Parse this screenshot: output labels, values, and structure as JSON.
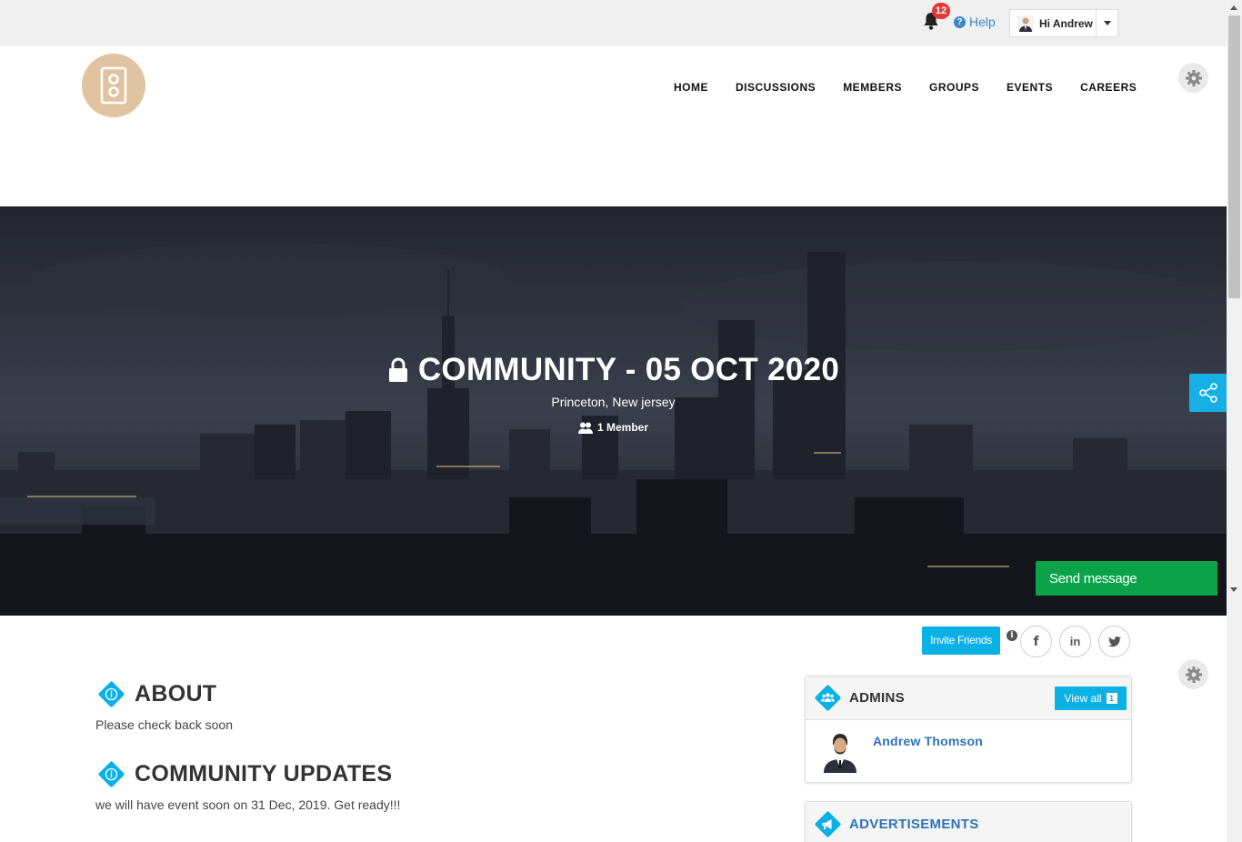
{
  "topbar": {
    "notification_count": "12",
    "help_label": "Help",
    "user_greeting": "Hi Andrew"
  },
  "nav": {
    "items": [
      {
        "label": "HOME"
      },
      {
        "label": "DISCUSSIONS"
      },
      {
        "label": "MEMBERS"
      },
      {
        "label": "GROUPS"
      },
      {
        "label": "EVENTS"
      },
      {
        "label": "CAREERS"
      }
    ]
  },
  "hero": {
    "title": "COMMUNITY - 05 OCT 2020",
    "location": "Princeton, New jersey",
    "members": "1 Member",
    "send_message": "Send message"
  },
  "actions": {
    "invite_label": "Invite Friends",
    "info_glyph": "i",
    "facebook_glyph": "f",
    "linkedin_glyph": "in"
  },
  "about": {
    "title": "ABOUT",
    "text": "Please check back soon"
  },
  "updates": {
    "title": "COMMUNITY UPDATES",
    "text": "we will have event soon on 31 Dec, 2019. Get ready!!!"
  },
  "admins": {
    "title": "ADMINS",
    "view_all_label": "View all",
    "count": "1",
    "people": [
      {
        "name": "Andrew Thomson"
      }
    ]
  },
  "advertisements": {
    "title": "ADVERTISEMENTS"
  },
  "colors": {
    "accent": "#0bb0e4",
    "send_message": "#0aa34a",
    "link": "#2e73b8",
    "badge": "#e53935",
    "logo": "#e0c4a1"
  }
}
